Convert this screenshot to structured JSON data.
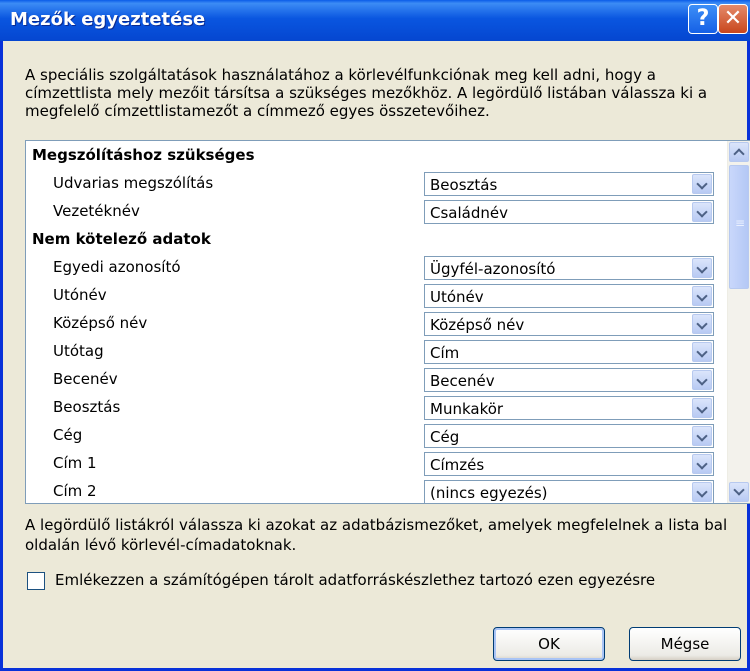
{
  "window": {
    "title": "Mezők egyeztetése",
    "help_glyph": "?",
    "close_glyph": "✕",
    "description": "A speciális szolgáltatások használatához a körlevélfunkciónak meg kell adni, hogy a címzettlista mely mezőit társítsa a szükséges mezőkhöz. A legördülő listában válassza ki a megfelelő címzettlistamezőt a címmező egyes összetevőihez."
  },
  "sections": [
    {
      "heading": "Megszólításhoz szükséges",
      "fields": [
        {
          "label": "Udvarias megszólítás",
          "value": "Beosztás"
        },
        {
          "label": "Vezetéknév",
          "value": "Családnév"
        }
      ]
    },
    {
      "heading": "Nem kötelező adatok",
      "fields": [
        {
          "label": "Egyedi azonosító",
          "value": "Ügyfél-azonosító"
        },
        {
          "label": "Utónév",
          "value": "Utónév"
        },
        {
          "label": "Középső név",
          "value": "Középső név"
        },
        {
          "label": "Utótag",
          "value": "Cím"
        },
        {
          "label": "Becenév",
          "value": "Becenév"
        },
        {
          "label": "Beosztás",
          "value": "Munkakör"
        },
        {
          "label": "Cég",
          "value": "Cég"
        },
        {
          "label": "Cím 1",
          "value": "Címzés"
        },
        {
          "label": "Cím 2",
          "value": "(nincs egyezés)"
        }
      ]
    }
  ],
  "hint": "A legördülő listákról válassza ki azokat az adatbázismezőket, amelyek megfelelnek a lista bal oldalán lévő körlevél-címadatoknak.",
  "remember_checkbox": {
    "label": "Emlékezzen a számítógépen tárolt adatforráskészlethez tartozó ezen egyezésre",
    "checked": false
  },
  "buttons": {
    "ok": "OK",
    "cancel": "Mégse"
  },
  "colors": {
    "titlebar": "#0a56e0",
    "dialog_bg": "#ece9d8",
    "frame": "#0831d9"
  }
}
